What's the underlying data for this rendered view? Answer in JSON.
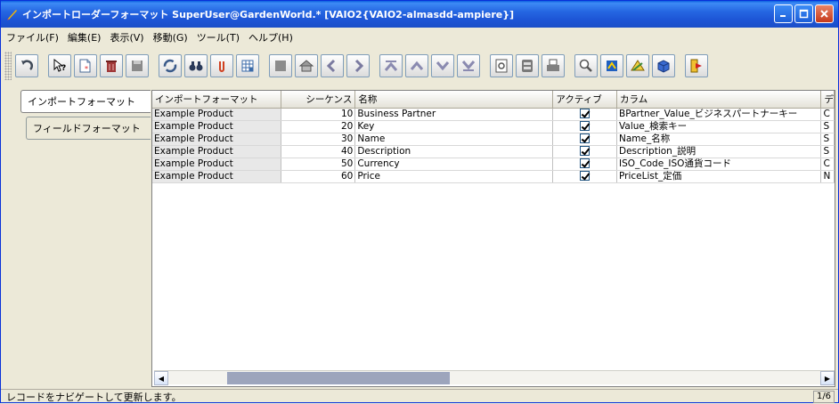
{
  "window": {
    "title": "インポートローダーフォーマット  SuperUser@GardenWorld.* [VAIO2{VAIO2-almasdd-ampiere}]"
  },
  "menu": [
    "ファイル(F)",
    "編集(E)",
    "表示(V)",
    "移動(G)",
    "ツール(T)",
    "ヘルプ(H)"
  ],
  "toolbar": {
    "icons": [
      "undo-icon",
      "help-icon",
      "new-icon",
      "delete-icon",
      "save-icon",
      "refresh-icon",
      "find-icon",
      "attachment-icon",
      "grid-toggle-icon",
      "history-icon",
      "home-icon",
      "previous-icon",
      "next-icon",
      "first-record-icon",
      "previous-record-icon",
      "next-record-icon",
      "last-record-icon",
      "report-icon",
      "archive-icon",
      "print-icon",
      "zoom-icon",
      "workflow-icon",
      "request-icon",
      "product-icon",
      "exit-icon"
    ]
  },
  "tabs": [
    {
      "label": "インポートフォーマット",
      "active": true
    },
    {
      "label": "フィールドフォーマット",
      "active": false
    }
  ],
  "table": {
    "columns": [
      "インポートフォーマット",
      "シーケンス",
      "名称",
      "アクティブ",
      "カラム",
      "デ"
    ],
    "rows": [
      {
        "format": "Example Product",
        "seq": "10",
        "name": "Business Partner",
        "active": true,
        "column": "BPartner_Value_ビジネスパートナーキー",
        "extra": "C"
      },
      {
        "format": "Example Product",
        "seq": "20",
        "name": "Key",
        "active": true,
        "column": "Value_検索キー",
        "extra": "S"
      },
      {
        "format": "Example Product",
        "seq": "30",
        "name": "Name",
        "active": true,
        "column": "Name_名称",
        "extra": "S"
      },
      {
        "format": "Example Product",
        "seq": "40",
        "name": "Description",
        "active": true,
        "column": "Description_説明",
        "extra": "S"
      },
      {
        "format": "Example Product",
        "seq": "50",
        "name": "Currency",
        "active": true,
        "column": "ISO_Code_ISO通貨コード",
        "extra": "C"
      },
      {
        "format": "Example Product",
        "seq": "60",
        "name": "Price",
        "active": true,
        "column": "PriceList_定価",
        "extra": "N"
      }
    ]
  },
  "status": {
    "message": "レコードをナビゲートして更新します。",
    "record_count": "1/6"
  },
  "colors": {
    "titlebar": "#1d55d6",
    "window_bg": "#ece9d8"
  }
}
